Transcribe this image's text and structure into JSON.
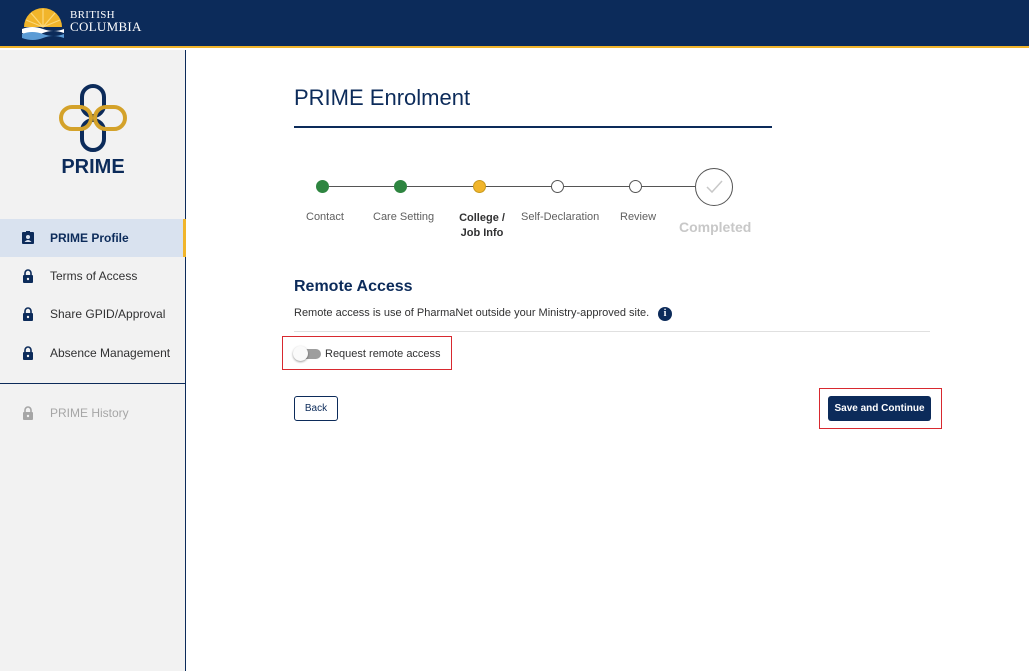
{
  "header": {
    "brand_line1": "BRITISH",
    "brand_line2": "COLUMBIA"
  },
  "sidebar": {
    "app_name": "PRIME",
    "items": [
      {
        "label": "PRIME Profile",
        "icon": "id-card-icon",
        "state": "active"
      },
      {
        "label": "Terms of Access",
        "icon": "lock-icon",
        "state": "normal"
      },
      {
        "label": "Share GPID/Approval",
        "icon": "lock-icon",
        "state": "normal"
      },
      {
        "label": "Absence Management",
        "icon": "lock-icon",
        "state": "normal"
      },
      {
        "label": "PRIME History",
        "icon": "lock-icon",
        "state": "disabled"
      }
    ]
  },
  "main": {
    "title": "PRIME Enrolment",
    "steps": [
      {
        "label": "Contact",
        "status": "done"
      },
      {
        "label": "Care Setting",
        "status": "done"
      },
      {
        "label": "College / Job Info",
        "status": "current"
      },
      {
        "label": "Self-Declaration",
        "status": "todo"
      },
      {
        "label": "Review",
        "status": "todo"
      },
      {
        "label": "Completed",
        "status": "final"
      }
    ],
    "section_title": "Remote Access",
    "section_description": "Remote access is use of PharmaNet outside your Ministry-approved site.",
    "info_glyph": "i",
    "toggle_label": "Request remote access",
    "toggle_on": false,
    "back_label": "Back",
    "save_label": "Save and Continue"
  },
  "colors": {
    "brand_navy": "#0c2b5a",
    "brand_gold": "#f1b52b",
    "step_done": "#2e8540",
    "highlight_red": "#d8292f"
  }
}
